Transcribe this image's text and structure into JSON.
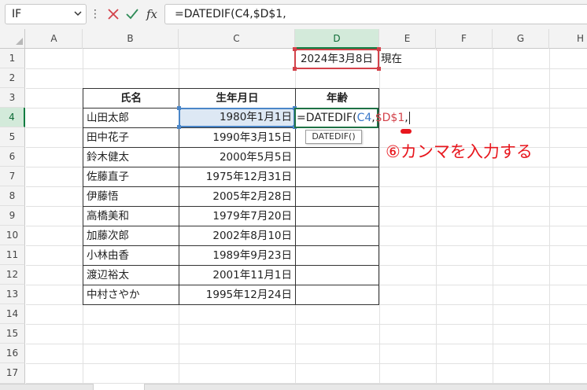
{
  "formula_bar": {
    "name_box": "IF",
    "formula": "=DATEDIF(C4,$D$1,",
    "icons": [
      "chevron-down-icon",
      "more-options-icon",
      "cancel-icon",
      "enter-checkmark-icon",
      "insert-function-icon"
    ],
    "fx_label": "fx",
    "dots": "⋮"
  },
  "columns": [
    "A",
    "B",
    "C",
    "D",
    "E",
    "F",
    "G",
    "H"
  ],
  "rows": [
    "1",
    "2",
    "3",
    "4",
    "5",
    "6",
    "7",
    "8",
    "9",
    "10",
    "11",
    "12",
    "13",
    "14",
    "15",
    "16",
    "17"
  ],
  "cells": {
    "d1": "2024年3月8日",
    "e1": "現在"
  },
  "table": {
    "headers": [
      "氏名",
      "生年月日",
      "年齢"
    ],
    "rows": [
      {
        "name": "山田太郎",
        "date": "1980年1月1日"
      },
      {
        "name": "田中花子",
        "date": "1990年3月15日"
      },
      {
        "name": "鈴木健太",
        "date": "2000年5月5日"
      },
      {
        "name": "佐藤直子",
        "date": "1975年12月31日"
      },
      {
        "name": "伊藤悟",
        "date": "2005年2月28日"
      },
      {
        "name": "高橋美和",
        "date": "1979年7月20日"
      },
      {
        "name": "加藤次郎",
        "date": "2002年8月10日"
      },
      {
        "name": "小林由香",
        "date": "1989年9月23日"
      },
      {
        "name": "渡辺裕太",
        "date": "2001年11月1日"
      },
      {
        "name": "中村さやか",
        "date": "1995年12月24日"
      }
    ]
  },
  "editing": {
    "prefix": "=DATEDIF(",
    "ref1": "C4",
    "sep": ",",
    "ref2": "$D$1",
    "tail": ",",
    "tooltip": "DATEDIF()"
  },
  "annotation": "⑥カンマを入力する",
  "colors": {
    "ref1": "#3a78c9",
    "ref2": "#d3424a",
    "annotation": "#e8161d",
    "selected_header": "#107c41"
  }
}
